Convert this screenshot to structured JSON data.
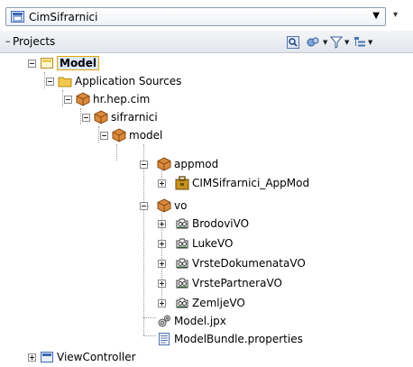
{
  "selector": {
    "value": "CimSifrarnici"
  },
  "panel": {
    "title": "Projects"
  },
  "icons": {
    "project": "project-icon",
    "folder": "folder-icon",
    "package": "package-icon",
    "app_module": "app-module-icon",
    "view_object": "view-object-icon",
    "jpx": "jpx-config-icon",
    "properties": "properties-file-icon"
  },
  "tree": {
    "model": "Model",
    "application_sources": "Application Sources",
    "pkg_hr_hep_cim": "hr.hep.cim",
    "pkg_sifrarnici": "sifrarnici",
    "pkg_model": "model",
    "pkg_appmod": "appmod",
    "app_module": "CIMSifrarnici_AppMod",
    "pkg_vo": "vo",
    "vo_items": [
      "BrodoviVO",
      "LukeVO",
      "VrsteDokumenataVO",
      "VrstePartneraVO",
      "ZemljeVO"
    ],
    "model_jpx": "Model.jpx",
    "model_bundle": "ModelBundle.properties",
    "view_controller": "ViewController"
  },
  "colors": {
    "selection_border": "#e0a700",
    "selection_fill": "#dbe8fb",
    "package": "#c8742a",
    "folder": "#f2c94c"
  }
}
